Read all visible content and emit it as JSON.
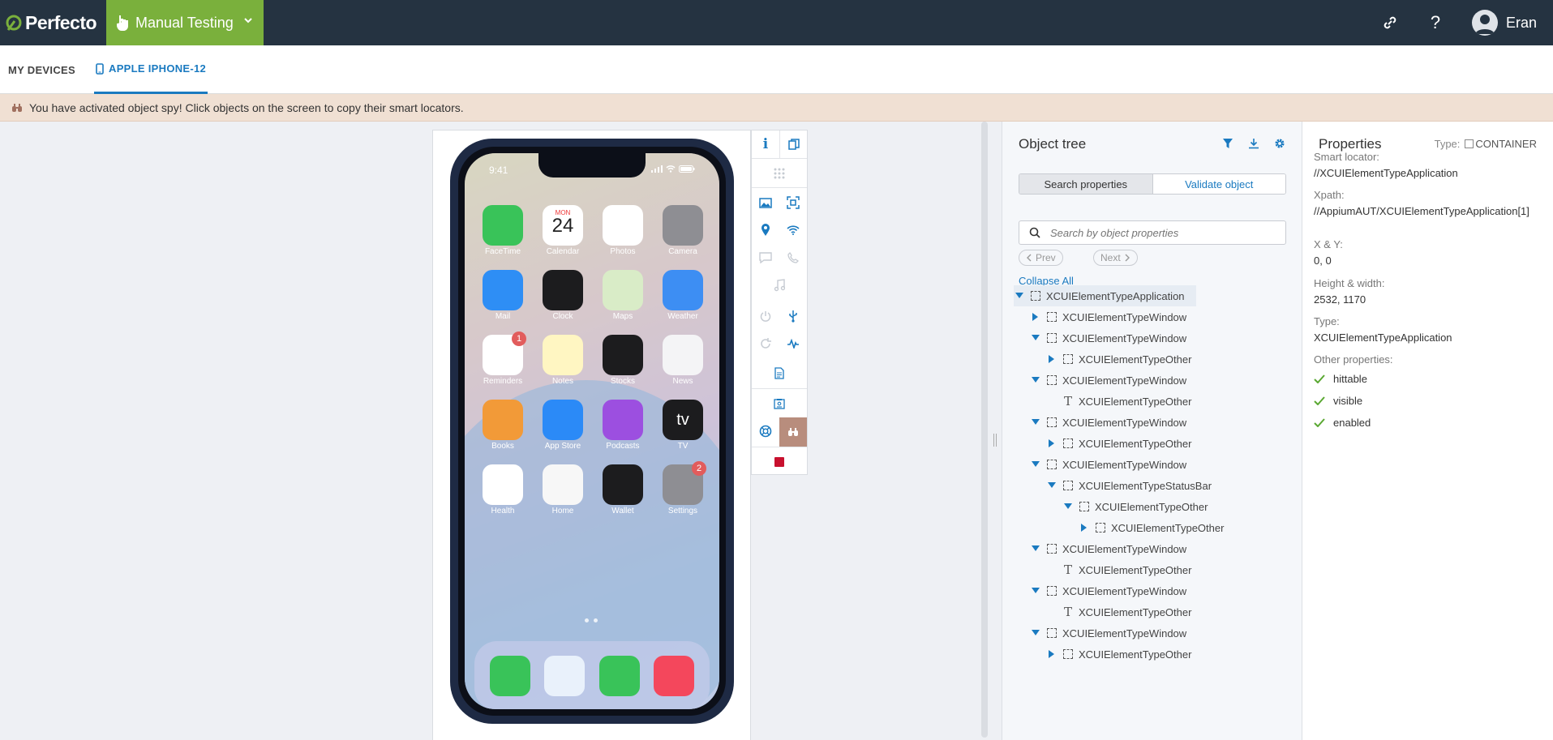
{
  "header": {
    "logo_text": "Perfecto",
    "app_name": "Manual Testing",
    "user_name": "Eran",
    "icons": {
      "link": "link-icon",
      "help": "help-icon",
      "avatar": "user-avatar"
    }
  },
  "tabs": [
    {
      "label": "MY DEVICES"
    },
    {
      "label": "APPLE IPHONE-12"
    }
  ],
  "banner": {
    "text": "You have activated object spy! Click objects on the screen to copy their smart locators."
  },
  "device": {
    "time": "9:41",
    "apps": [
      {
        "label": "FaceTime",
        "color": "#39c359",
        "icon": "facetime-icon"
      },
      {
        "label": "Calendar",
        "color": "#ffffff",
        "icon": "calendar-icon",
        "day": "MON",
        "date": "24"
      },
      {
        "label": "Photos",
        "color": "#ffffff",
        "icon": "photos-icon"
      },
      {
        "label": "Camera",
        "color": "#8e8e93",
        "icon": "camera-icon"
      },
      {
        "label": "Mail",
        "color": "#2e8ef5",
        "icon": "mail-icon"
      },
      {
        "label": "Clock",
        "color": "#1c1c1e",
        "icon": "clock-icon"
      },
      {
        "label": "Maps",
        "color": "#d9ecc7",
        "icon": "maps-icon"
      },
      {
        "label": "Weather",
        "color": "#3d8ef3",
        "icon": "weather-icon"
      },
      {
        "label": "Reminders",
        "color": "#ffffff",
        "icon": "reminders-icon",
        "badge": "1"
      },
      {
        "label": "Notes",
        "color": "#fff6c2",
        "icon": "notes-icon"
      },
      {
        "label": "Stocks",
        "color": "#1c1c1e",
        "icon": "stocks-icon"
      },
      {
        "label": "News",
        "color": "#f4f4f6",
        "icon": "news-icon"
      },
      {
        "label": "Books",
        "color": "#f29a38",
        "icon": "books-icon"
      },
      {
        "label": "App Store",
        "color": "#2b8af7",
        "icon": "appstore-icon"
      },
      {
        "label": "Podcasts",
        "color": "#9c4fe0",
        "icon": "podcasts-icon"
      },
      {
        "label": "TV",
        "color": "#1c1c1e",
        "icon": "tv-icon",
        "text": "tv"
      },
      {
        "label": "Health",
        "color": "#ffffff",
        "icon": "health-icon"
      },
      {
        "label": "Home",
        "color": "#f7f7f7",
        "icon": "home-icon"
      },
      {
        "label": "Wallet",
        "color": "#1c1c1e",
        "icon": "wallet-icon"
      },
      {
        "label": "Settings",
        "color": "#8e8e93",
        "icon": "settings-icon",
        "badge": "2"
      }
    ],
    "dock": [
      {
        "icon": "phone-icon",
        "color": "#39c359"
      },
      {
        "icon": "safari-icon",
        "color": "#e9f1fb"
      },
      {
        "icon": "messages-icon",
        "color": "#39c359"
      },
      {
        "icon": "music-icon",
        "color": "#f4475c"
      }
    ]
  },
  "toolbar": {
    "icons": [
      "info-icon",
      "copy-icon",
      "grid-icon",
      "image-icon",
      "scan-icon",
      "location-icon",
      "wifi-icon",
      "message-icon",
      "call-icon",
      "music-icon",
      "power-icon",
      "usb-icon",
      "vitals-icon",
      "log-icon",
      "report-icon",
      "lifebuoy-icon",
      "object-spy-icon",
      "stop-record-icon"
    ],
    "spy_active_color": "#b88d7d",
    "record_color": "#c8102e"
  },
  "object_tree": {
    "title": "Object tree",
    "tools": [
      "filter-icon",
      "download-icon",
      "settings-icon"
    ],
    "search_properties_label": "Search properties",
    "validate_object_label": "Validate object",
    "search_placeholder": "Search by object properties",
    "prev_label": "Prev",
    "next_label": "Next",
    "collapse_all": "Collapse All",
    "nodes": [
      {
        "label": "XCUIElementTypeApplication",
        "depth": 0,
        "arrow": "down",
        "icon": "box",
        "selected": true
      },
      {
        "label": "XCUIElementTypeWindow",
        "depth": 1,
        "arrow": "right",
        "icon": "box"
      },
      {
        "label": "XCUIElementTypeWindow",
        "depth": 1,
        "arrow": "down",
        "icon": "box"
      },
      {
        "label": "XCUIElementTypeOther",
        "depth": 2,
        "arrow": "right",
        "icon": "box"
      },
      {
        "label": "XCUIElementTypeWindow",
        "depth": 1,
        "arrow": "down",
        "icon": "box"
      },
      {
        "label": "XCUIElementTypeOther",
        "depth": 2,
        "arrow": "none",
        "icon": "text"
      },
      {
        "label": "XCUIElementTypeWindow",
        "depth": 1,
        "arrow": "down",
        "icon": "box"
      },
      {
        "label": "XCUIElementTypeOther",
        "depth": 2,
        "arrow": "right",
        "icon": "box"
      },
      {
        "label": "XCUIElementTypeWindow",
        "depth": 1,
        "arrow": "down",
        "icon": "box"
      },
      {
        "label": "XCUIElementTypeStatusBar",
        "depth": 2,
        "arrow": "down",
        "icon": "box"
      },
      {
        "label": "XCUIElementTypeOther",
        "depth": 3,
        "arrow": "down",
        "icon": "box"
      },
      {
        "label": "XCUIElementTypeOther",
        "depth": 4,
        "arrow": "right",
        "icon": "box"
      },
      {
        "label": "XCUIElementTypeWindow",
        "depth": 1,
        "arrow": "down",
        "icon": "box"
      },
      {
        "label": "XCUIElementTypeOther",
        "depth": 2,
        "arrow": "none",
        "icon": "text"
      },
      {
        "label": "XCUIElementTypeWindow",
        "depth": 1,
        "arrow": "down",
        "icon": "box"
      },
      {
        "label": "XCUIElementTypeOther",
        "depth": 2,
        "arrow": "none",
        "icon": "text"
      },
      {
        "label": "XCUIElementTypeWindow",
        "depth": 1,
        "arrow": "down",
        "icon": "box"
      },
      {
        "label": "XCUIElementTypeOther",
        "depth": 2,
        "arrow": "right",
        "icon": "box"
      }
    ]
  },
  "properties": {
    "title": "Properties",
    "type_label": "Type:",
    "type_value": "CONTAINER",
    "fields": [
      {
        "key": "Smart locator:",
        "value": "//XCUIElementTypeApplication"
      },
      {
        "key": "Xpath:",
        "value": "//AppiumAUT/XCUIElementTypeApplication[1]"
      },
      {
        "key": "X & Y:",
        "value": "0, 0"
      },
      {
        "key": "Height & width:",
        "value": "2532, 1170"
      },
      {
        "key": "Type:",
        "value": "XCUIElementTypeApplication"
      }
    ],
    "other_label": "Other properties:",
    "checks": [
      "hittable",
      "visible",
      "enabled"
    ],
    "check_color": "#5aa832"
  },
  "colors": {
    "topbar": "#253341",
    "accent_green": "#7ab03c",
    "link_blue": "#1a7ac0",
    "banner": "#f0e0d3"
  }
}
